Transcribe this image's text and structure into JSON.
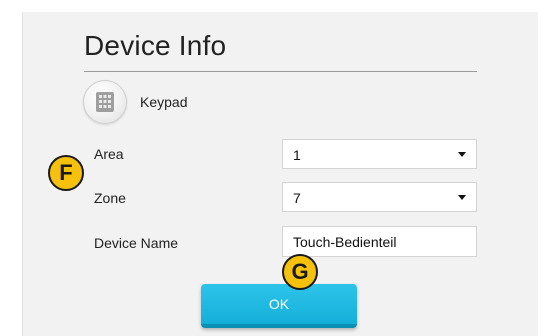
{
  "header": {
    "title": "Device Info"
  },
  "device": {
    "icon": "keypad-icon",
    "label": "Keypad"
  },
  "form": {
    "area": {
      "label": "Area",
      "value": "1"
    },
    "zone": {
      "label": "Zone",
      "value": "7"
    },
    "device_name": {
      "label": "Device Name",
      "value": "Touch-Bedienteil"
    }
  },
  "actions": {
    "ok_label": "OK"
  },
  "markers": {
    "f": "F",
    "g": "G"
  },
  "colors": {
    "accent": "#1ab6e0",
    "marker": "#f5c10c",
    "panel_bg": "#f2f2f2"
  }
}
